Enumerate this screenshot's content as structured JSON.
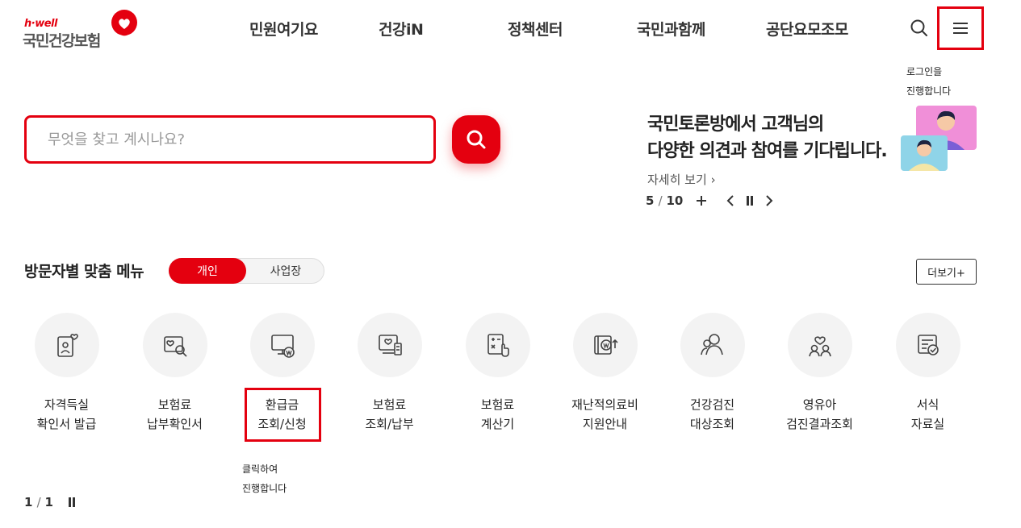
{
  "logo": {
    "small": "h·well",
    "main": "국민건강보험"
  },
  "gnb": [
    {
      "label": "민원여기요"
    },
    {
      "label": "건강iN"
    },
    {
      "label": "정책센터"
    },
    {
      "label": "국민과함께"
    },
    {
      "label": "공단요모조모"
    }
  ],
  "tips": {
    "login_line1": "로그인을",
    "login_line2": "진행합니다",
    "click_line1": "클릭하여",
    "click_line2": "진행합니다"
  },
  "search": {
    "placeholder": "무엇을 찾고 계시나요?",
    "value": ""
  },
  "banner": {
    "title_line1": "국민토론방에서 고객님의",
    "title_line2": "다양한 의견과 참여를 기다립니다.",
    "more": "자세히 보기",
    "current": "5",
    "total": "10"
  },
  "section": {
    "title": "방문자별 맞춤 메뉴",
    "toggle_on": "개인",
    "toggle_off": "사업장",
    "more": "더보기+"
  },
  "menu_items": [
    {
      "line1": "자격득실",
      "line2": "확인서 발급",
      "icon": "id-card-heart-icon"
    },
    {
      "line1": "보험료",
      "line2": "납부확인서",
      "icon": "certificate-search-icon"
    },
    {
      "line1": "환급금",
      "line2": "조회/신청",
      "icon": "monitor-won-icon"
    },
    {
      "line1": "보험료",
      "line2": "조회/납부",
      "icon": "document-heart-icon"
    },
    {
      "line1": "보험료",
      "line2": "계산기",
      "icon": "calculator-touch-icon"
    },
    {
      "line1": "재난적의료비",
      "line2": "지원안내",
      "icon": "medical-fund-icon"
    },
    {
      "line1": "건강검진",
      "line2": "대상조회",
      "icon": "people-check-icon"
    },
    {
      "line1": "영유아",
      "line2": "검진결과조회",
      "icon": "family-heart-icon"
    },
    {
      "line1": "서식",
      "line2": "자료실",
      "icon": "form-check-icon"
    }
  ],
  "pager": {
    "current": "1",
    "total": "1"
  },
  "colors": {
    "brand": "#e4000f",
    "text": "#222222",
    "circle_bg": "#f3f3f3"
  }
}
